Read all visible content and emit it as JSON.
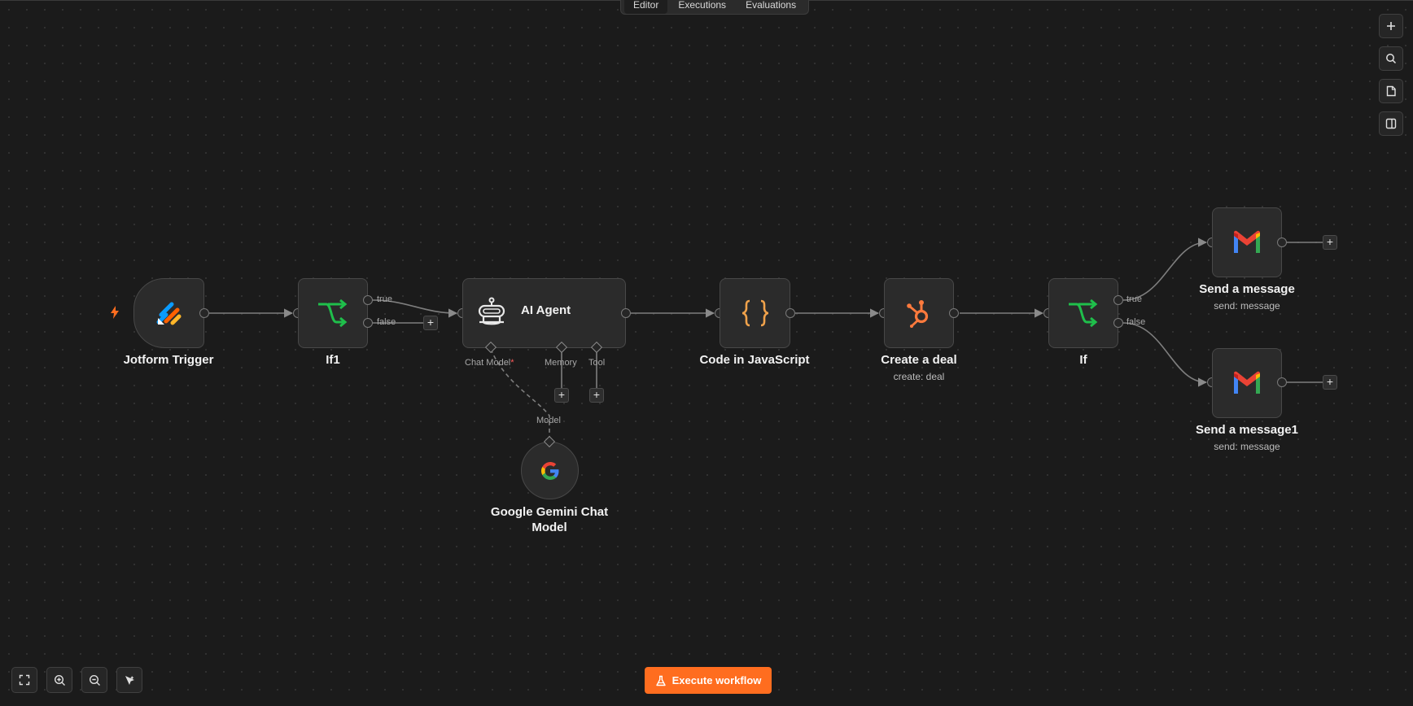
{
  "tabs": [
    {
      "label": "Editor",
      "active": true
    },
    {
      "label": "Executions",
      "active": false
    },
    {
      "label": "Evaluations",
      "active": false
    }
  ],
  "right_toolbar": [
    "plus-icon",
    "search-icon",
    "sticky-note-icon",
    "panel-icon"
  ],
  "bottom_toolbar": [
    "fit-view-icon",
    "zoom-in-icon",
    "zoom-out-icon",
    "tidy-up-icon"
  ],
  "nodes": {
    "jotform": {
      "label": "Jotform Trigger",
      "icon": "jotform-icon"
    },
    "if1": {
      "label": "If1",
      "icon": "if-branch-icon",
      "outputs": [
        "true",
        "false"
      ]
    },
    "ai_agent": {
      "label": "AI Agent",
      "icon": "robot-icon",
      "inputs": {
        "chat_model": "Chat Model",
        "required_mark": "*",
        "memory": "Memory",
        "tool": "Tool"
      }
    },
    "code": {
      "label": "Code in JavaScript",
      "icon": "code-braces-icon"
    },
    "deal": {
      "label": "Create a deal",
      "subtitle": "create: deal",
      "icon": "hubspot-icon"
    },
    "if": {
      "label": "If",
      "icon": "if-branch-icon",
      "outputs": [
        "true",
        "false"
      ]
    },
    "send1": {
      "label": "Send a message",
      "subtitle": "send: message",
      "icon": "gmail-icon"
    },
    "send2": {
      "label": "Send a message1",
      "subtitle": "send: message",
      "icon": "gmail-icon"
    },
    "gemini": {
      "label_line1": "Google Gemini Chat",
      "label_line2": "Model",
      "port_label": "Model",
      "icon": "google-icon"
    }
  },
  "execute_button": {
    "label": "Execute workflow",
    "icon": "flask-icon"
  },
  "colors": {
    "background": "#1b1b1b",
    "node": "#2b2b2b",
    "accent": "#ff6d1f",
    "if_green": "#1fbf4b",
    "code_orange": "#f0a24b",
    "hubspot": "#ff7a3d"
  }
}
